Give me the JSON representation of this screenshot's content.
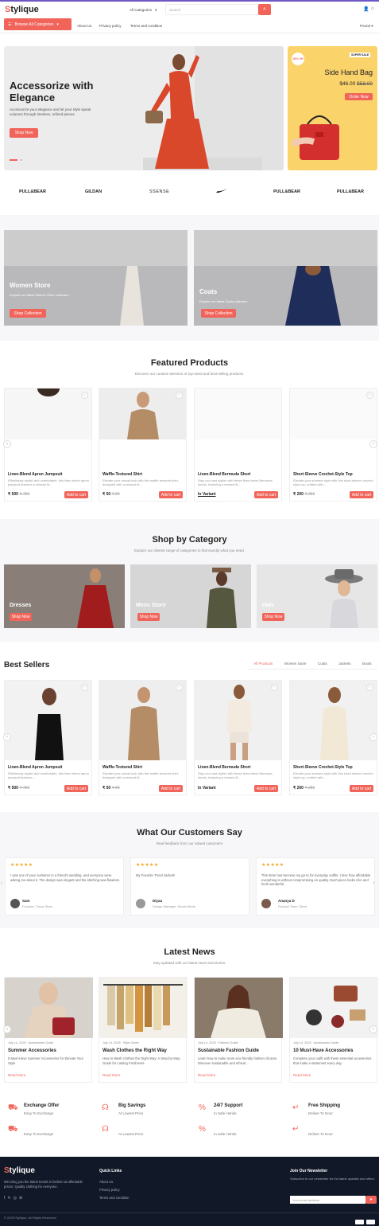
{
  "header": {
    "logo_first": "S",
    "logo_rest": "tylique",
    "category_select": "All Categories",
    "search_placeholder": "Search"
  },
  "nav": {
    "browse_label": "Browse All Categories",
    "links": [
      "About Us",
      "Privacy policy",
      "Terms and condition"
    ],
    "currency": "Pound"
  },
  "hero": {
    "title_line1": "Accessorize with",
    "title_line2": "Elegance",
    "subtitle": "Accessorize your elegance and let your style speak volumes through timeless, refined pieces.",
    "cta": "Shop Now"
  },
  "promo": {
    "badge": "25% Off",
    "sale_tag": "SUPER SALE",
    "title": "Side Hand Bag",
    "price": "$46.00",
    "old_price": "$58.00",
    "cta": "Order Now"
  },
  "brands": [
    "PULL&BEAR",
    "GILDAN",
    "SSENSE",
    "nike-logo",
    "PULL&BEAR",
    "PULL&BEAR"
  ],
  "store_banners": [
    {
      "title": "Women Store",
      "subtitle": "Explore our latest Women Store collection.",
      "cta": "Shop Collection"
    },
    {
      "title": "Coats",
      "subtitle": "Explore our latest Coats collection.",
      "cta": "Shop Collection"
    }
  ],
  "featured": {
    "title": "Featured Products",
    "subtitle": "Discover our curated selection of top-rated and best-selling products.",
    "products": [
      {
        "name": "Linen-Blend Apron Jumpsuit",
        "desc": "Effortlessly stylish and comfortable, this linen-blend apron jumpsuit features a relaxed fit...",
        "price": "₹ 500",
        "old": "₹ 750",
        "cta": "Add to cart"
      },
      {
        "name": "Waffle-Textured Shirt",
        "desc": "Elevate your casual look with this waffle-textured shirt, designed with a relaxed fit...",
        "price": "₹ 50",
        "old": "₹ 80",
        "cta": "Add to cart"
      },
      {
        "name": "Linen-Blend Bermuda Short",
        "desc": "Stay cool and stylish with these linen-blend Bermuda shorts, featuring a relaxed fit...",
        "price": "In Variant",
        "old": "",
        "cta": "Add to cart"
      },
      {
        "name": "Short-Sleeve Crochet-Style Top",
        "desc": "Elevate your summer style with this short-sleeve crochet-style top, crafted with...",
        "price": "₹ 200",
        "old": "₹ 250",
        "cta": "Add to cart"
      }
    ]
  },
  "shop_by_category": {
    "title": "Shop by Category",
    "subtitle": "Explore our diverse range of categories to find exactly what you need.",
    "items": [
      {
        "title": "Dresses",
        "cta": "Shop Now"
      },
      {
        "title": "Mens Store",
        "cta": "Shop Now"
      },
      {
        "title": "Hats",
        "cta": "Shop Now"
      }
    ]
  },
  "best_sellers": {
    "title": "Best Sellers",
    "tabs": [
      "All Products",
      "Women Store",
      "Coats",
      "Jackets",
      "Boots"
    ],
    "products": [
      {
        "name": "Linen-Blend Apron Jumpsuit",
        "desc": "Effortlessly stylish and comfortable, this linen-blend apron jumpsuit features...",
        "price": "₹ 500",
        "old": "₹ 750",
        "cta": "Add to cart"
      },
      {
        "name": "Waffle-Textured Shirt",
        "desc": "Elevate your casual look with this waffle-textured shirt, designed with a relaxed fit...",
        "price": "₹ 50",
        "old": "₹ 80",
        "cta": "Add to cart"
      },
      {
        "name": "Linen-Blend Bermuda Short",
        "desc": "Stay cool and stylish with these linen-blend Bermuda shorts, featuring a relaxed fit...",
        "price": "In Variant",
        "old": "",
        "cta": "Add to cart"
      },
      {
        "name": "Short-Sleeve Crochet-Style Top",
        "desc": "Elevate your summer style with this short-sleeve crochet-style top, crafted with...",
        "price": "₹ 200",
        "old": "₹ 280",
        "cta": "Add to cart"
      }
    ]
  },
  "testimonials": {
    "title": "What Our Customers Say",
    "subtitle": "Real feedback from our valued customers",
    "stars": "★★★★★",
    "items": [
      {
        "text": "I was one of your customer in a friend's wedding, and everyone were asking me about it. The design was elegant and the stitching was flawless.",
        "name": "Sam",
        "role": "Founder, Cloud Store"
      },
      {
        "text": "My Favorite Trend Jacket!!",
        "name": "Diyaa",
        "role": "Design Manager, Studio Mode"
      },
      {
        "text": "This store has become my go-to for everyday outfits. I love how affordable everything is without compromising on quality. Each piece looks chic and feels wonderful.",
        "name": "Ananya D",
        "role": "Product Team Client"
      }
    ]
  },
  "news": {
    "title": "Latest News",
    "subtitle": "Stay updated with our latest news and stories.",
    "items": [
      {
        "meta": "July 14, 2025 · Accessories Guide",
        "title": "Summer Accessories",
        "desc": "5 Must-Have Summer Accessories for Elevate Your Style",
        "cta": "Read More"
      },
      {
        "meta": "July 14, 2025 · Style Guide",
        "title": "Wash Clothes the Right Way",
        "desc": "How to Wash Clothes the Right Way: A Step-by-Step Guide for Lasting Freshness",
        "cta": "Read More"
      },
      {
        "meta": "July 14, 2025 · Fashion Guide",
        "title": "Sustainable Fashion Guide",
        "desc": "Learn how to make more eco-friendly fashion choices. Discover sustainable and ethical ...",
        "cta": "Read More"
      },
      {
        "meta": "July 14, 2025 · Accessories Guide",
        "title": "10 Must-Have Accessories",
        "desc": "Complete your outfit with these essential accessories that make a statement every day.",
        "cta": "Read More"
      }
    ]
  },
  "features": [
    {
      "title": "Exchange Offer",
      "sub": "Easy To Exchange",
      "icon": "truck-icon"
    },
    {
      "title": "Big Savings",
      "sub": "At Lowest Price",
      "icon": "headset-icon"
    },
    {
      "title": "24/7 Support",
      "sub": "In Safe Hands",
      "icon": "percent-icon"
    },
    {
      "title": "Free Shipping",
      "sub": "Deliver To Door",
      "icon": "arrow-icon"
    }
  ],
  "features_repeat": [
    {
      "sub": "Easy To Exchange"
    },
    {
      "sub": "At Lowest Price"
    },
    {
      "sub": "In Safe Hands"
    },
    {
      "sub": "Deliver To Door"
    }
  ],
  "footer": {
    "about": "We bring you the latest trends in fashion at affordable prices. Quality clothing for everyone.",
    "quick_links_title": "Quick Links",
    "quick_links": [
      "About Us",
      "Privacy policy",
      "Terms and condition"
    ],
    "newsletter_title": "Join Our Newsletter",
    "newsletter_text": "Subscribe to our newsletter for the latest updates and offers.",
    "email_placeholder": "Your email address",
    "copyright": "© 2025 Stylique. All Rights Reserved."
  },
  "colors": {
    "accent": "#f0645a",
    "footer_bg": "#111827",
    "promo_bg": "#fbd36b"
  }
}
